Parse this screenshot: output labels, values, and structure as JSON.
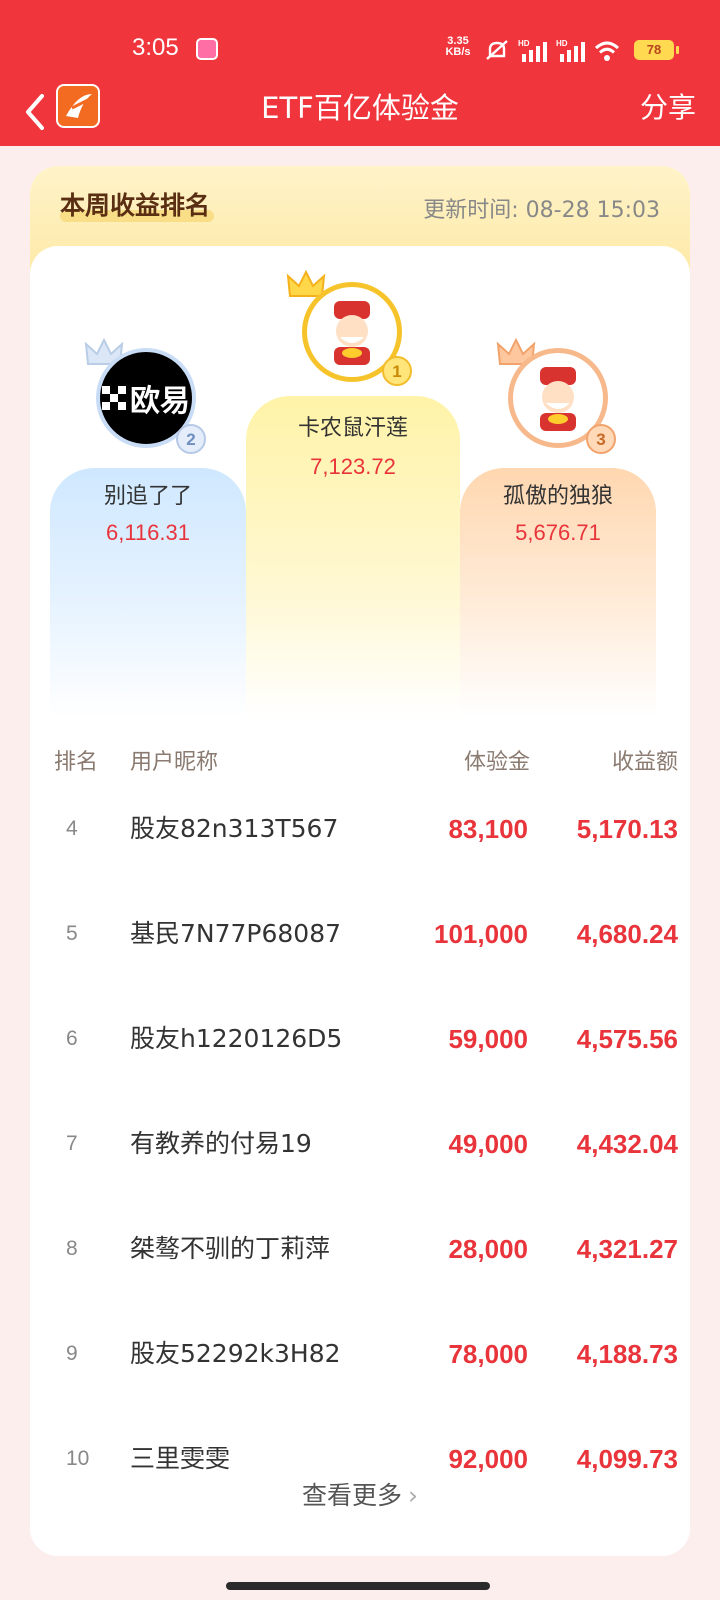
{
  "status_bar": {
    "time": "3:05",
    "net_speed_top": "3.35",
    "net_speed_bottom": "KB/s",
    "battery": "78"
  },
  "header": {
    "title": "ETF百亿体验金",
    "share_label": "分享"
  },
  "ranking": {
    "title": "本周收益排名",
    "update_label": "更新时间: 08-28 15:03",
    "podium": [
      {
        "rank": "1",
        "name": "卡农鼠汗莲",
        "score": "7,123.72"
      },
      {
        "rank": "2",
        "name": "别追了了",
        "score": "6,116.31",
        "avatar_text": "欧易"
      },
      {
        "rank": "3",
        "name": "孤傲的独狼",
        "score": "5,676.71"
      }
    ],
    "columns": {
      "rank": "排名",
      "nickname": "用户昵称",
      "amount": "体验金",
      "profit": "收益额"
    },
    "rows": [
      {
        "rank": "4",
        "nickname": "股友82n313T567",
        "amount": "83,100",
        "profit": "5,170.13"
      },
      {
        "rank": "5",
        "nickname": "基民7N77P68087",
        "amount": "101,000",
        "profit": "4,680.24"
      },
      {
        "rank": "6",
        "nickname": "股友h1220126D5",
        "amount": "59,000",
        "profit": "4,575.56"
      },
      {
        "rank": "7",
        "nickname": "有教养的付易19",
        "amount": "49,000",
        "profit": "4,432.04"
      },
      {
        "rank": "8",
        "nickname": "桀骜不驯的丁莉萍",
        "amount": "28,000",
        "profit": "4,321.27"
      },
      {
        "rank": "9",
        "nickname": "股友52292k3H82",
        "amount": "78,000",
        "profit": "4,188.73"
      },
      {
        "rank": "10",
        "nickname": "三里雯雯",
        "amount": "92,000",
        "profit": "4,099.73"
      }
    ],
    "more_label": "查看更多"
  },
  "colors": {
    "brand_red": "#f0353c",
    "value_red": "#e8343a",
    "gold": "#f6c42a"
  }
}
